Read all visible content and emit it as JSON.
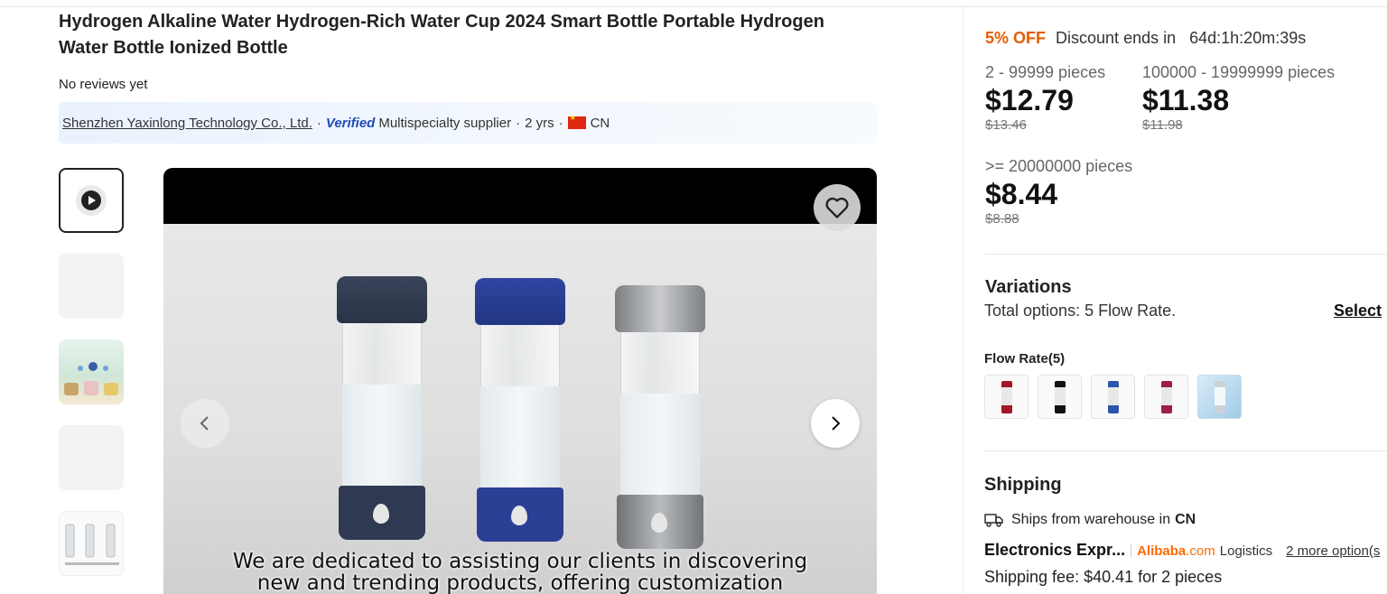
{
  "product": {
    "title": "Hydrogen Alkaline Water Hydrogen-Rich Water Cup 2024 Smart Bottle Portable Hydrogen Water Bottle Ionized Bottle",
    "reviews": "No reviews yet"
  },
  "supplier": {
    "name": "Shenzhen Yaxinlong Technology Co., Ltd.",
    "dot1": "·",
    "verified": "Verified",
    "type": "Multispecialty supplier",
    "dot2": "·",
    "years": "2 yrs",
    "dot3": "·",
    "country": "CN"
  },
  "media": {
    "caption_line1": "We are dedicated to assisting our clients in discovering",
    "caption_line2": "new and trending products, offering customization"
  },
  "pricing": {
    "discount_label": "5% OFF",
    "discount_text": "Discount ends in",
    "countdown": "64d:1h:20m:39s",
    "tiers": [
      {
        "qty": "2 - 99999 pieces",
        "price": "$12.79",
        "original": "$13.46"
      },
      {
        "qty": "100000 - 19999999 pieces",
        "price": "$11.38",
        "original": "$11.98"
      },
      {
        "qty": ">= 20000000 pieces",
        "price": "$8.44",
        "original": "$8.88"
      }
    ]
  },
  "variations": {
    "title": "Variations",
    "total_options": "Total options: 5 Flow Rate.",
    "select_label": "Select",
    "flow_rate_label": "Flow Rate(5)",
    "swatch_colors": [
      "#a3162b",
      "#111111",
      "#2b55a8",
      "#9c1e4a",
      "#dce9f2"
    ]
  },
  "shipping": {
    "title": "Shipping",
    "ships_from_prefix": "Ships from warehouse in",
    "ships_from_country": "CN",
    "method": "Electronics Expr...",
    "brand_main": "Alibaba",
    "brand_domain": ".com",
    "brand_suffix": "Logistics",
    "more_options": "2 more option(s",
    "fee": "Shipping fee: $40.41 for 2 pieces"
  }
}
